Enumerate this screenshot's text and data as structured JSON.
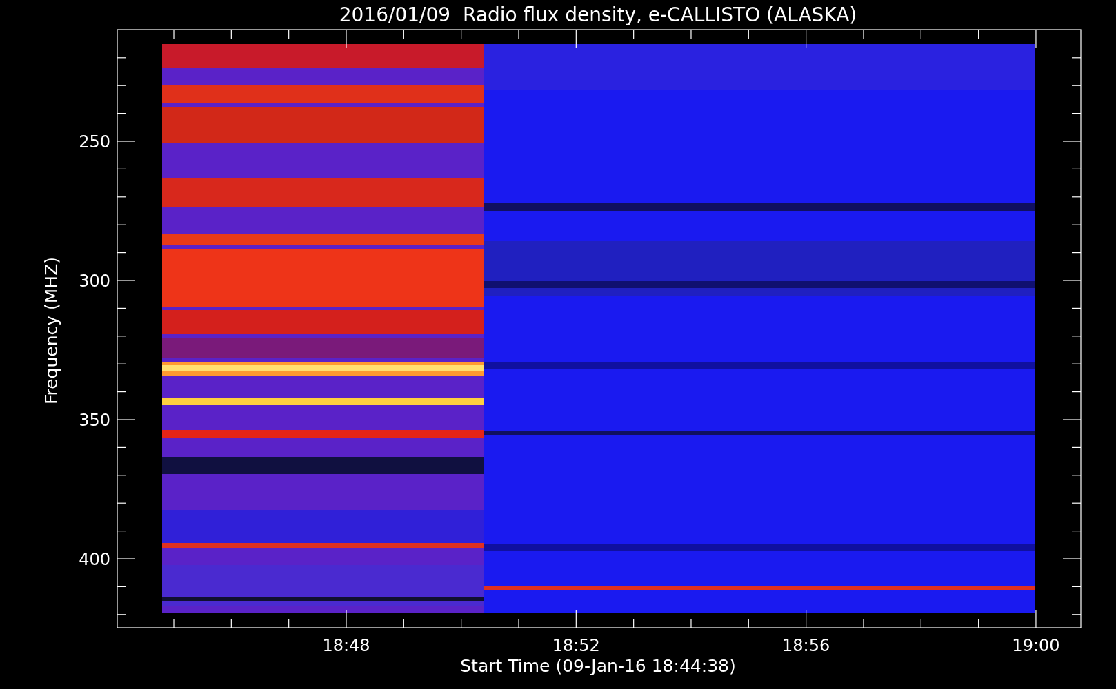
{
  "title": "2016/01/09  Radio flux density, e-CALLISTO (ALASKA)",
  "y_axis": {
    "label": "Frequency (MHZ)",
    "ticks": [
      "250",
      "300",
      "350",
      "400"
    ]
  },
  "x_axis": {
    "label": "Start Time (09-Jan-16 18:44:38)",
    "ticks": [
      "18:48",
      "18:52",
      "18:56",
      "19:00"
    ]
  }
}
